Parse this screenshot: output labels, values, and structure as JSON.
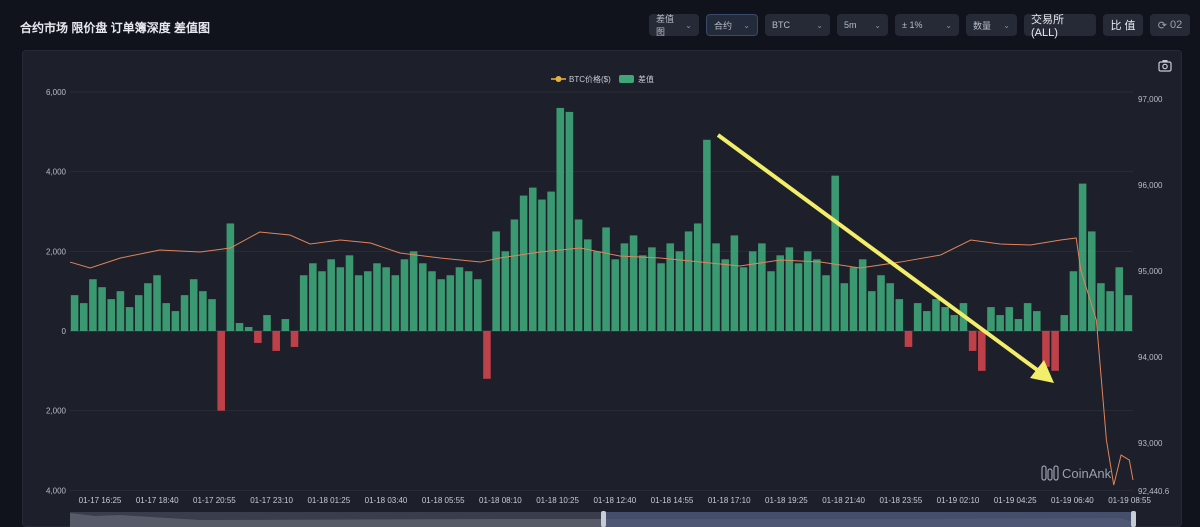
{
  "header": {
    "title": "合约市场 限价盘 订单簿深度 差值图"
  },
  "toolbar": {
    "chart_type": "差值图",
    "market": "合约",
    "coin": "BTC",
    "interval": "5m",
    "range": "± 1%",
    "unit": "数量",
    "exchange": "交易所 (ALL)",
    "ratio": "比 值",
    "refresh": "02"
  },
  "icons": {
    "camera": "camera-icon",
    "refresh": "refresh-icon",
    "chevron": "chevron-down-icon"
  },
  "watermark": "CoinAnk",
  "chart_data": {
    "type": "bar+line",
    "legend": [
      "BTC价格($)",
      "差值"
    ],
    "legend_placement": "top-center",
    "colors": {
      "positive": "#3fa67a",
      "negative": "#d0444d",
      "price": "#e0845a",
      "legend_price": "#e8b33a"
    },
    "left_axis": {
      "ticks": [
        6000,
        4000,
        2000,
        0,
        -2000,
        -4000
      ],
      "tick_labels": [
        "6,000",
        "4,000",
        "2,000",
        "0",
        "2,000",
        "4,000"
      ],
      "range": [
        -4000,
        6000
      ]
    },
    "right_axis": {
      "ticks": [
        97000,
        96000,
        95000,
        94000,
        93000
      ],
      "tick_labels": [
        "97,000",
        "96,000",
        "95,000",
        "94,000",
        "93,000",
        "92,440.6"
      ],
      "range": [
        92440.6,
        97200
      ]
    },
    "x_tick_labels": [
      "01-17 16:25",
      "01-17 18:40",
      "01-17 20:55",
      "01-17 23:10",
      "01-18 01:25",
      "01-18 03:40",
      "01-18 05:55",
      "01-18 08:10",
      "01-18 10:25",
      "01-18 12:40",
      "01-18 14:55",
      "01-18 17:10",
      "01-18 19:25",
      "01-18 21:40",
      "01-18 23:55",
      "01-19 02:10",
      "01-19 04:25",
      "01-19 06:40",
      "01-19 08:55"
    ],
    "diff_values": [
      900,
      700,
      1300,
      1100,
      800,
      1000,
      600,
      900,
      1200,
      1400,
      700,
      500,
      900,
      1300,
      1000,
      800,
      -2000,
      2700,
      200,
      100,
      -300,
      400,
      -500,
      300,
      -400,
      1400,
      1700,
      1500,
      1800,
      1600,
      1900,
      1400,
      1500,
      1700,
      1600,
      1400,
      1800,
      2000,
      1700,
      1500,
      1300,
      1400,
      1600,
      1500,
      1300,
      -1200,
      2500,
      2000,
      2800,
      3400,
      3600,
      3300,
      3500,
      5600,
      5500,
      2800,
      2300,
      2000,
      2600,
      1800,
      2200,
      2400,
      1900,
      2100,
      1700,
      2200,
      2000,
      2500,
      2700,
      4800,
      2200,
      1800,
      2400,
      1600,
      2000,
      2200,
      1500,
      1900,
      2100,
      1700,
      2000,
      1800,
      1400,
      3900,
      1200,
      1600,
      1800,
      1000,
      1400,
      1200,
      800,
      -400,
      700,
      500,
      800,
      600,
      400,
      700,
      -500,
      -1000,
      600,
      400,
      600,
      300,
      700,
      500,
      -900,
      -1000,
      400,
      1500,
      3700,
      2500,
      1200,
      1000,
      1600,
      900
    ],
    "price_series": [
      [
        0,
        95104
      ],
      [
        2.2,
        95035
      ],
      [
        5.5,
        95151
      ],
      [
        9.8,
        95244
      ],
      [
        14.2,
        95221
      ],
      [
        17.5,
        95267
      ],
      [
        20.7,
        95453
      ],
      [
        24,
        95418
      ],
      [
        26.2,
        95314
      ],
      [
        29.5,
        95360
      ],
      [
        32.8,
        95325
      ],
      [
        36,
        95209
      ],
      [
        40.4,
        95151
      ],
      [
        44.8,
        95104
      ],
      [
        46.9,
        95151
      ],
      [
        51.3,
        95221
      ],
      [
        55.7,
        95267
      ],
      [
        60,
        95174
      ],
      [
        64.4,
        95151
      ],
      [
        68.8,
        95104
      ],
      [
        73.1,
        95058
      ],
      [
        77.5,
        95128
      ],
      [
        81.9,
        95104
      ],
      [
        86.2,
        95035
      ],
      [
        90.6,
        95104
      ],
      [
        95,
        95186
      ],
      [
        98.3,
        95360
      ],
      [
        101.5,
        95314
      ],
      [
        104.8,
        95302
      ],
      [
        108.1,
        95360
      ],
      [
        109.8,
        95384
      ],
      [
        110.3,
        95012
      ],
      [
        112,
        94430
      ],
      [
        113.1,
        93034
      ],
      [
        113.9,
        92511
      ],
      [
        114.7,
        92860
      ],
      [
        115.6,
        92802
      ],
      [
        116,
        92569
      ]
    ]
  }
}
